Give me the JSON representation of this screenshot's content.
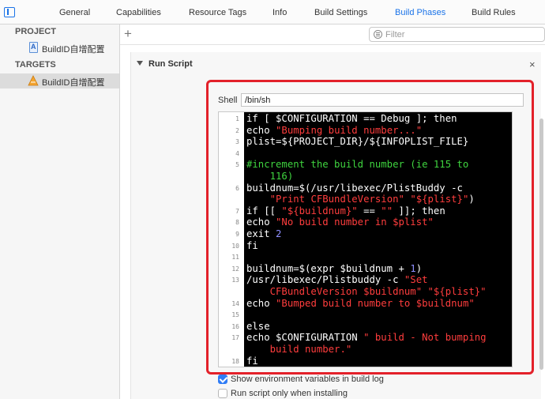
{
  "tabs": [
    "General",
    "Capabilities",
    "Resource Tags",
    "Info",
    "Build Settings",
    "Build Phases",
    "Build Rules"
  ],
  "active_tab": "Build Phases",
  "sidebar": {
    "project_header": "PROJECT",
    "project_item": "BuildID自增配置",
    "targets_header": "TARGETS",
    "target_item": "BuildID自增配置"
  },
  "toolbar": {
    "add_symbol": "+",
    "filter_placeholder": "Filter"
  },
  "phase": {
    "title": "Run Script",
    "close_symbol": "×",
    "shell_label": "Shell",
    "shell_value": "/bin/sh"
  },
  "script_lines": [
    {
      "n": "1",
      "segs": [
        {
          "t": "if [ $CONFIGURATION == Debug ]; then",
          "c": "plain"
        }
      ]
    },
    {
      "n": "2",
      "segs": [
        {
          "t": "echo ",
          "c": "plain"
        },
        {
          "t": "\"Bumping build number...\"",
          "c": "str"
        }
      ]
    },
    {
      "n": "3",
      "segs": [
        {
          "t": "plist=${PROJECT_DIR}/${INFOPLIST_FILE}",
          "c": "plain"
        }
      ]
    },
    {
      "n": "4",
      "segs": []
    },
    {
      "n": "5",
      "segs": [
        {
          "t": "#increment the build number (ie 115 to",
          "c": "cmt"
        }
      ]
    },
    {
      "n": "",
      "segs": [
        {
          "t": "    116)",
          "c": "cmt"
        }
      ]
    },
    {
      "n": "6",
      "segs": [
        {
          "t": "buildnum=$(/usr/libexec/PlistBuddy -c",
          "c": "plain"
        }
      ]
    },
    {
      "n": "",
      "segs": [
        {
          "t": "    ",
          "c": "plain"
        },
        {
          "t": "\"Print CFBundleVersion\"",
          "c": "str"
        },
        {
          "t": " ",
          "c": "plain"
        },
        {
          "t": "\"${plist}\"",
          "c": "str"
        },
        {
          "t": ")",
          "c": "plain"
        }
      ]
    },
    {
      "n": "7",
      "segs": [
        {
          "t": "if [[ ",
          "c": "plain"
        },
        {
          "t": "\"${buildnum}\"",
          "c": "str"
        },
        {
          "t": " == ",
          "c": "plain"
        },
        {
          "t": "\"\"",
          "c": "str"
        },
        {
          "t": " ]]; then",
          "c": "plain"
        }
      ]
    },
    {
      "n": "8",
      "segs": [
        {
          "t": "echo ",
          "c": "plain"
        },
        {
          "t": "\"No build number in $plist\"",
          "c": "str"
        }
      ]
    },
    {
      "n": "9",
      "segs": [
        {
          "t": "exit ",
          "c": "plain"
        },
        {
          "t": "2",
          "c": "num"
        }
      ]
    },
    {
      "n": "10",
      "segs": [
        {
          "t": "fi",
          "c": "plain"
        }
      ]
    },
    {
      "n": "11",
      "segs": []
    },
    {
      "n": "12",
      "segs": [
        {
          "t": "buildnum=$(expr $buildnum + ",
          "c": "plain"
        },
        {
          "t": "1",
          "c": "num"
        },
        {
          "t": ")",
          "c": "plain"
        }
      ]
    },
    {
      "n": "13",
      "segs": [
        {
          "t": "/usr/libexec/Plistbuddy -c ",
          "c": "plain"
        },
        {
          "t": "\"Set",
          "c": "str"
        }
      ]
    },
    {
      "n": "",
      "segs": [
        {
          "t": "    CFBundleVersion $buildnum\" \"${plist}\"",
          "c": "str"
        }
      ]
    },
    {
      "n": "14",
      "segs": [
        {
          "t": "echo ",
          "c": "plain"
        },
        {
          "t": "\"Bumped build number to $buildnum\"",
          "c": "str"
        }
      ]
    },
    {
      "n": "15",
      "segs": []
    },
    {
      "n": "16",
      "segs": [
        {
          "t": "else",
          "c": "plain"
        }
      ]
    },
    {
      "n": "17",
      "segs": [
        {
          "t": "echo $CONFIGURATION ",
          "c": "plain"
        },
        {
          "t": "\" build - Not bumping",
          "c": "str"
        }
      ]
    },
    {
      "n": "",
      "segs": [
        {
          "t": "    build number.\"",
          "c": "str"
        }
      ]
    },
    {
      "n": "18",
      "segs": [
        {
          "t": "fi",
          "c": "plain"
        }
      ]
    }
  ],
  "options": [
    {
      "label": "Show environment variables in build log",
      "checked": true
    },
    {
      "label": "Run script only when installing",
      "checked": false
    }
  ],
  "colors": {
    "accent": "#1a73e8",
    "highlight_border": "#e3212a",
    "code_bg": "#000000",
    "code_text": "#ffffff",
    "code_string": "#ff3d3d",
    "code_comment": "#3fd43f",
    "code_number": "#8f8fff"
  }
}
